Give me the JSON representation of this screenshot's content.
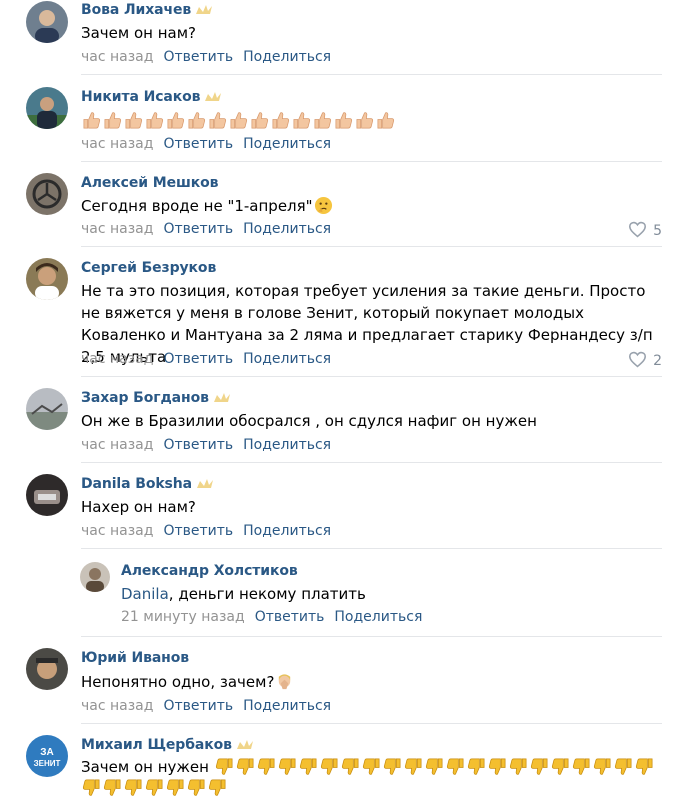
{
  "colors": {
    "link": "#2a5885",
    "meta": "#939393",
    "divider": "#e4e6e9"
  },
  "comments": [
    {
      "name": "Вова Лихачев",
      "text": "Зачем он нам?",
      "time": "час назад",
      "reply": "Ответить",
      "share": "Поделиться"
    },
    {
      "name": "Никита Исаков",
      "text": "",
      "emoji": "thumbs-up x15",
      "time": "час назад",
      "reply": "Ответить",
      "share": "Поделиться"
    },
    {
      "name": "Алексей Мешков",
      "text": "Сегодня вроде не \"1-апреля\"",
      "emoji": "thinking-face",
      "time": "час назад",
      "reply": "Ответить",
      "share": "Поделиться",
      "likes": "5"
    },
    {
      "name": "Сергей Безруков",
      "text": "Не та это позиция, которая требует усиления за такие деньги. Просто не вяжется у меня в голове Зенит, который покупает молодых Коваленко и Мантуана за 2 ляма и предлагает старику Фернандесу з/п 2,5 мульта",
      "time": "час назад",
      "reply": "Ответить",
      "share": "Поделиться",
      "likes": "2"
    },
    {
      "name": "Захар Богданов",
      "text": "Он же в Бразилии обосрался , он сдулся нафиг он нужен",
      "time": "час назад",
      "reply": "Ответить",
      "share": "Поделиться"
    },
    {
      "name": "Danila Boksha",
      "text": "Нахер он нам?",
      "time": "час назад",
      "reply": "Ответить",
      "share": "Поделиться"
    },
    {
      "name": "Александр Холстиков",
      "reply_to": "Danila",
      "text": ", деньги некому платить",
      "time": "21 минуту назад",
      "reply": "Ответить",
      "share": "Поделиться"
    },
    {
      "name": "Юрий Иванов",
      "text": "Непонятно одно, зачем?",
      "emoji": "facepalm",
      "time": "час назад",
      "reply": "Ответить",
      "share": "Поделиться"
    },
    {
      "name": "Михаил Щербаков",
      "text": "Зачем он нужен",
      "emoji": "thumbs-down x28",
      "avatar_text": "ЗА ЗЕНИТ"
    }
  ]
}
